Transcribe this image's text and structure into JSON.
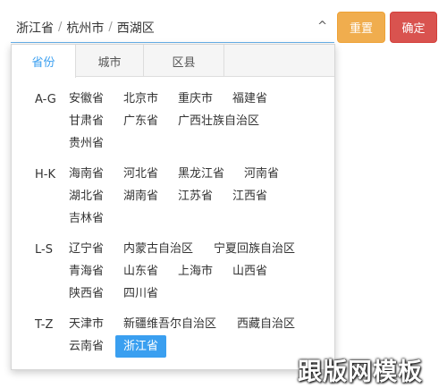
{
  "selector": {
    "province": "浙江省",
    "city": "杭州市",
    "district": "西湖区",
    "separator": "/",
    "caret": "^"
  },
  "buttons": {
    "reset": "重置",
    "confirm": "确定"
  },
  "tabs": [
    {
      "label": "省份",
      "active": true
    },
    {
      "label": "城市",
      "active": false
    },
    {
      "label": "区县",
      "active": false
    }
  ],
  "groups": [
    {
      "label": "A-G",
      "rows": [
        [
          "安徽省",
          "北京市",
          "重庆市",
          "福建省"
        ],
        [
          "甘肃省",
          "广东省",
          "广西壮族自治区"
        ],
        [
          "贵州省"
        ]
      ]
    },
    {
      "label": "H-K",
      "rows": [
        [
          "海南省",
          "河北省",
          "黑龙江省",
          "河南省"
        ],
        [
          "湖北省",
          "湖南省",
          "江苏省",
          "江西省"
        ],
        [
          "吉林省"
        ]
      ]
    },
    {
      "label": "L-S",
      "rows": [
        [
          "辽宁省",
          "内蒙古自治区",
          "宁夏回族自治区"
        ],
        [
          "青海省",
          "山东省",
          "上海市",
          "山西省"
        ],
        [
          "陕西省",
          "四川省"
        ]
      ]
    },
    {
      "label": "T-Z",
      "rows": [
        [
          "天津市",
          "新疆维吾尔自治区",
          "西藏自治区"
        ],
        [
          "云南省",
          "浙江省"
        ]
      ]
    }
  ],
  "selected_item": "浙江省",
  "watermark": "跟版网模板",
  "colors": {
    "accent": "#3a9ff0",
    "reset": "#f0ad4e",
    "confirm": "#d9534f"
  }
}
